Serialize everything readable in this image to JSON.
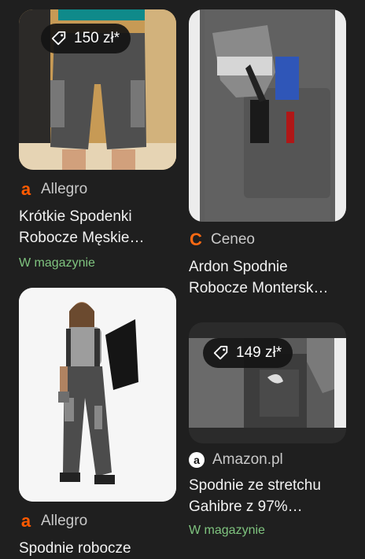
{
  "cards": [
    {
      "price": "150 zł*",
      "source": "Allegro",
      "title_line1": "Krótkie Spodenki",
      "title_line2": "Robocze Męskie…",
      "stock": "W magazynie"
    },
    {
      "source": "Ceneo",
      "title_line1": "Ardon Spodnie",
      "title_line2": "Robocze Montersk…"
    },
    {
      "source": "Allegro",
      "title_line1": "Spodnie robocze"
    },
    {
      "price": "149 zł*",
      "source": "Amazon.pl",
      "title_line1": "Spodnie ze stretchu",
      "title_line2": "Gahibre z 97%…",
      "stock": "W magazynie"
    }
  ],
  "colors": {
    "background": "#1f1f1f",
    "stock_green": "#7fc47f",
    "allegro_orange": "#ff5a00"
  }
}
